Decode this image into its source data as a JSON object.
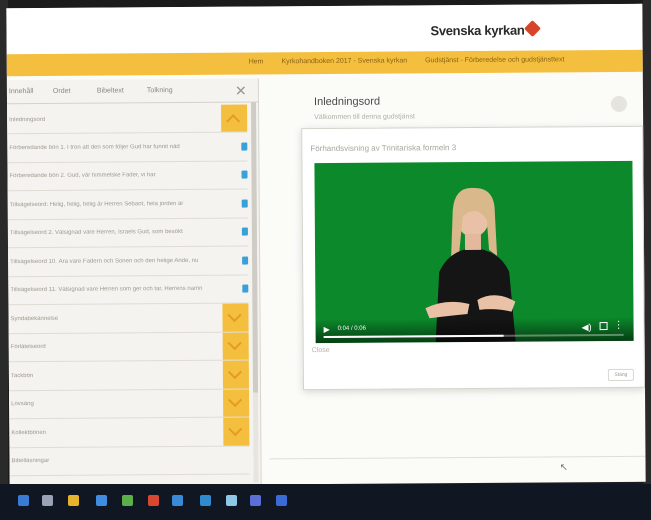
{
  "brand": {
    "name": "Svenska kyrkan"
  },
  "crumbs": [
    "Hem",
    "Kyrkohandboken 2017 - Svenska kyrkan",
    "Gudstjänst - Förberedelse och gudstjänsttext"
  ],
  "left_panel": {
    "tabs": [
      "Innehåll",
      "Ordet",
      "Bibeltext",
      "Tolkning"
    ],
    "rows": [
      {
        "text": "Inledningsord",
        "type": "chevron-up"
      },
      {
        "text": "Förberedande bön 1. I tron att den som följer Gud har funnit nåd",
        "type": "tick"
      },
      {
        "text": "Förberedande bön 2. Gud, vår himmelske Fader, vi har",
        "type": "tick"
      },
      {
        "text": "Tillsägelseord: Helig, helig, helig är Herren Sebaot, hela jorden är",
        "type": "tick"
      },
      {
        "text": "Tillsägelseord 2. Välsignad vare Herren, Israels Gud, som besökt",
        "type": "tick"
      },
      {
        "text": "Tillsägelseord 10. Ära vare Fadern och Sonen och den helige Ande, nu",
        "type": "tick"
      },
      {
        "text": "Tillsägelseord 11. Välsignad vare Herren som ger och tar, Herrens namn",
        "type": "tick"
      },
      {
        "text": "Syndabekännelse",
        "type": "chevron"
      },
      {
        "text": "Förlåtelseord",
        "type": "chevron"
      },
      {
        "text": "Tackbön",
        "type": "chevron"
      },
      {
        "text": "Lovsång",
        "type": "chevron"
      },
      {
        "text": "Kollektbönen",
        "type": "chevron"
      },
      {
        "text": "Bibelläsningar",
        "type": "none"
      }
    ]
  },
  "content": {
    "title": "Inledningsord",
    "subtitle": "Välkommen till denna gudstjänst"
  },
  "modal": {
    "title": "Förhandsvisning av Trinitariska formeln 3",
    "caption": "Close",
    "close_label": "Stäng",
    "video": {
      "time": "0:04 / 0:06",
      "progress": 0.6
    }
  },
  "taskbar": {
    "icons": [
      "start-icon",
      "search-icon",
      "task-view-icon",
      "file-explorer-icon",
      "edge-icon",
      "chrome-icon",
      "store-icon",
      "mail-icon",
      "photos-icon",
      "teams-icon",
      "settings-icon"
    ]
  }
}
